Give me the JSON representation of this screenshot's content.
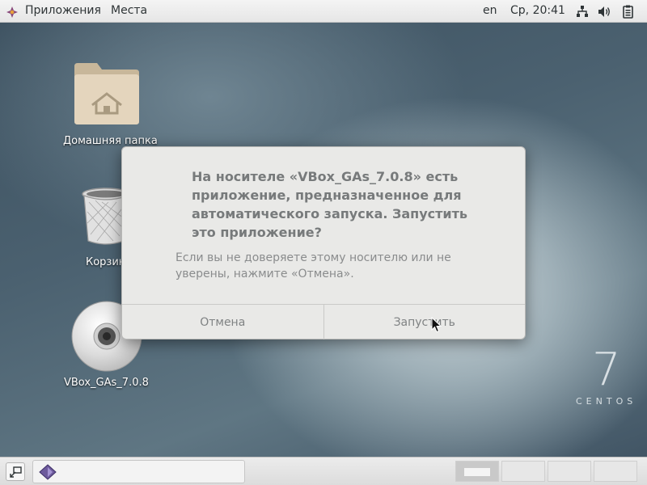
{
  "topbar": {
    "applications": "Приложения",
    "places": "Места",
    "language": "en",
    "clock": "Ср, 20:41"
  },
  "desktop": {
    "icons": [
      {
        "label": "Домашняя папка",
        "icon": "home-folder-icon"
      },
      {
        "label": "Корзина",
        "icon": "trash-icon"
      },
      {
        "label": "VBox_GAs_7.0.8",
        "icon": "cd-disc-icon"
      }
    ],
    "watermark": {
      "number": "7",
      "brand": "CENTOS"
    }
  },
  "dialog": {
    "primary_text": "На носителе «VBox_GAs_7.0.8» есть приложение, предназначенное для автоматического запуска. Запустить это приложение?",
    "secondary_text": "Если вы не доверяете этому носителю или не уверены, нажмите «Отмена».",
    "cancel_label": "Отмена",
    "run_label": "Запустить"
  },
  "bottombar": {
    "workspace_count": 4,
    "active_workspace": 1
  }
}
